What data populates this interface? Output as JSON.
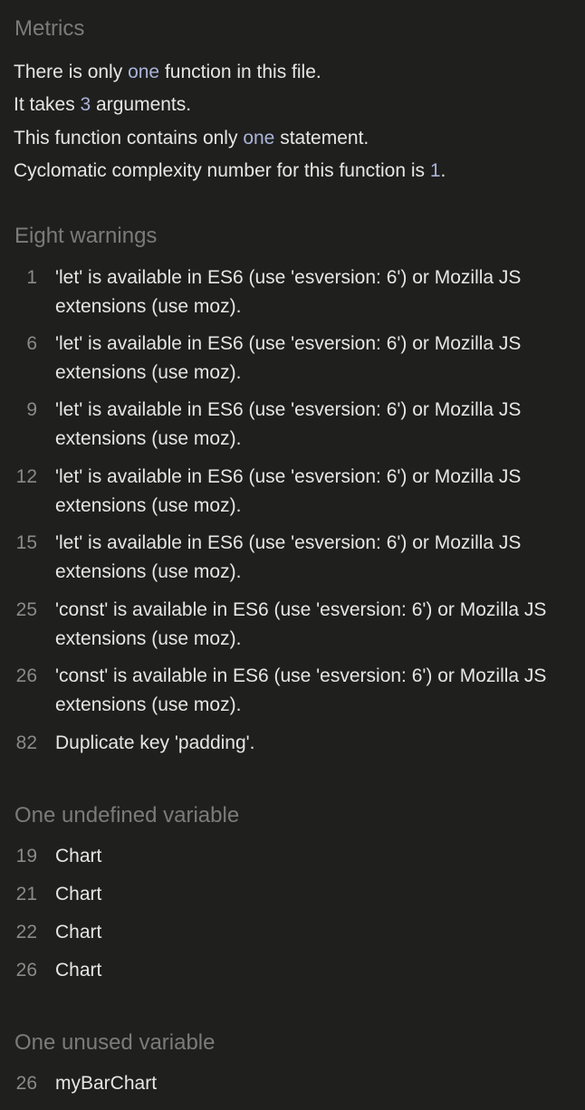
{
  "metrics": {
    "title": "Metrics",
    "line1": {
      "pre": "There is only ",
      "hl": "one",
      "post": " function in this file."
    },
    "line2": {
      "pre": "It takes ",
      "hl": "3",
      "post": " arguments."
    },
    "line3": {
      "pre": "This function contains only ",
      "hl": "one",
      "post": " statement."
    },
    "line4": {
      "pre": "Cyclomatic complexity number for this function is ",
      "hl": "1",
      "post": "."
    }
  },
  "warnings": {
    "title": "Eight warnings",
    "items": [
      {
        "line": "1",
        "text": "'let' is available in ES6 (use 'esversion: 6') or Mozilla JS extensions (use moz)."
      },
      {
        "line": "6",
        "text": "'let' is available in ES6 (use 'esversion: 6') or Mozilla JS extensions (use moz)."
      },
      {
        "line": "9",
        "text": "'let' is available in ES6 (use 'esversion: 6') or Mozilla JS extensions (use moz)."
      },
      {
        "line": "12",
        "text": "'let' is available in ES6 (use 'esversion: 6') or Mozilla JS extensions (use moz)."
      },
      {
        "line": "15",
        "text": "'let' is available in ES6 (use 'esversion: 6') or Mozilla JS extensions (use moz)."
      },
      {
        "line": "25",
        "text": "'const' is available in ES6 (use 'esversion: 6') or Mozilla JS extensions (use moz)."
      },
      {
        "line": "26",
        "text": "'const' is available in ES6 (use 'esversion: 6') or Mozilla JS extensions (use moz)."
      },
      {
        "line": "82",
        "text": "Duplicate key 'padding'."
      }
    ]
  },
  "undefined_vars": {
    "title": "One undefined variable",
    "items": [
      {
        "line": "19",
        "text": "Chart"
      },
      {
        "line": "21",
        "text": "Chart"
      },
      {
        "line": "22",
        "text": "Chart"
      },
      {
        "line": "26",
        "text": "Chart"
      }
    ]
  },
  "unused_vars": {
    "title": "One unused variable",
    "items": [
      {
        "line": "26",
        "text": "myBarChart"
      }
    ]
  },
  "colors": {
    "background": "#1f1f1e",
    "text": "#e6e6e6",
    "muted": "#7b7b7b",
    "highlight": "#aab4d8"
  }
}
